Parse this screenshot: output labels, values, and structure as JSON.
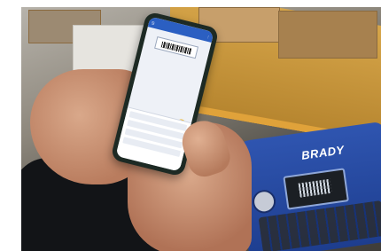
{
  "photo": {
    "printer_brand": "BRADY",
    "phone_app_bar_title": "",
    "scene": "warehouse-shelving"
  },
  "colors": {
    "printer_body": "#2f55b0",
    "shelf": "#d7a64a",
    "app_bar": "#2b5fc2",
    "fab": "#f0b21a"
  }
}
